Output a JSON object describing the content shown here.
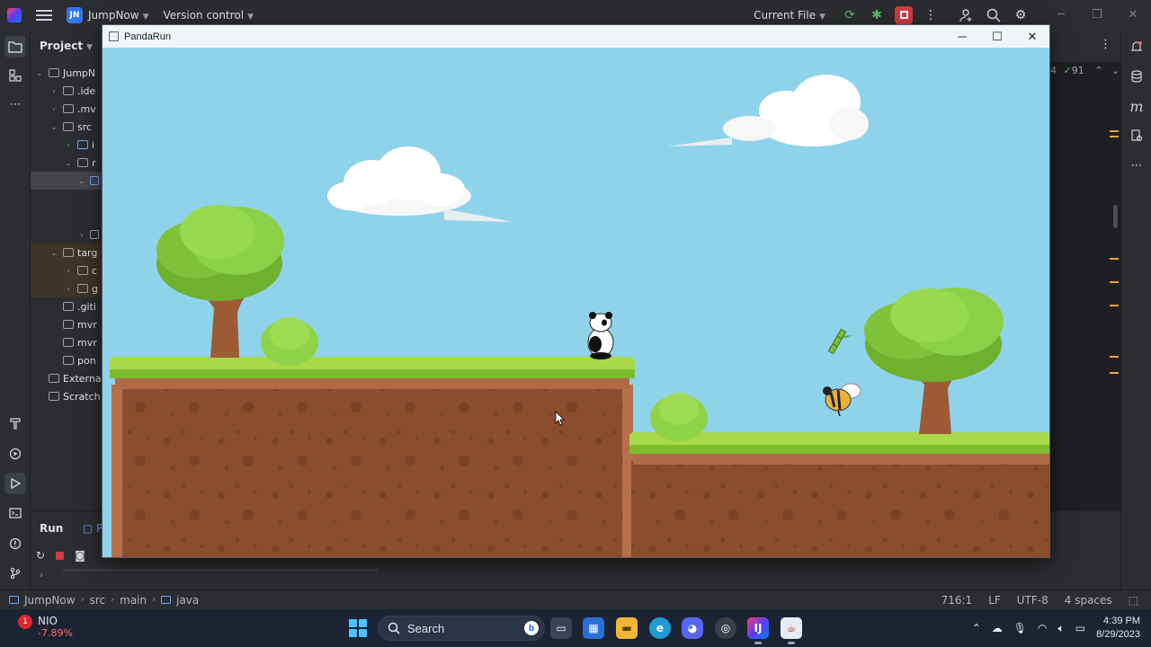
{
  "ide": {
    "project_badge": "JN",
    "project_name": "JumpNow",
    "vcs_label": "Version control",
    "run_config": "Current File",
    "project_panel_title": "Project",
    "tree": [
      {
        "label": "JumpN",
        "depth": 1,
        "expanded": true,
        "kind": "module"
      },
      {
        "label": ".ide",
        "depth": 2,
        "expanded": false,
        "kind": "folder"
      },
      {
        "label": ".mv",
        "depth": 2,
        "expanded": false,
        "kind": "folder"
      },
      {
        "label": "src",
        "depth": 2,
        "expanded": true,
        "kind": "folder"
      },
      {
        "label": "i",
        "depth": 3,
        "expanded": false,
        "kind": "folder-blue"
      },
      {
        "label": "r",
        "depth": 3,
        "expanded": true,
        "kind": "folder"
      },
      {
        "label": "",
        "depth": 4,
        "expanded": true,
        "kind": "selected"
      },
      {
        "label": "",
        "depth": 4,
        "expanded": false,
        "kind": "blank"
      },
      {
        "label": "",
        "depth": 4,
        "expanded": false,
        "kind": "blank"
      },
      {
        "label": "",
        "depth": 4,
        "expanded": false,
        "kind": "folder"
      },
      {
        "label": "targ",
        "depth": 2,
        "expanded": true,
        "kind": "excluded"
      },
      {
        "label": "c",
        "depth": 3,
        "expanded": false,
        "kind": "excluded"
      },
      {
        "label": "g",
        "depth": 3,
        "expanded": false,
        "kind": "excluded"
      },
      {
        "label": ".giti",
        "depth": 2,
        "expanded": false,
        "kind": "file"
      },
      {
        "label": "mvr",
        "depth": 2,
        "expanded": false,
        "kind": "file"
      },
      {
        "label": "mvr",
        "depth": 2,
        "expanded": false,
        "kind": "file"
      },
      {
        "label": "pon",
        "depth": 2,
        "expanded": false,
        "kind": "file"
      },
      {
        "label": "Externa",
        "depth": 1,
        "expanded": false,
        "kind": "file"
      },
      {
        "label": "Scratch",
        "depth": 1,
        "expanded": false,
        "kind": "file"
      }
    ],
    "inspection_warnings": "4",
    "inspection_ok": "91",
    "run_tab": "Run",
    "run_tab_2": "P",
    "breadcrumb": [
      "JumpNow",
      "src",
      "main",
      "java"
    ],
    "status": {
      "position": "716:1",
      "line_sep": "LF",
      "encoding": "UTF-8",
      "indent": "4 spaces"
    }
  },
  "game_window": {
    "title": "PandaRun",
    "sky_color": "#8fd3eb"
  },
  "taskbar": {
    "stock_badge": "1",
    "stock_symbol": "NIO",
    "stock_change": "-7.89%",
    "search_placeholder": "Search",
    "time": "4:39 PM",
    "date": "8/29/2023"
  }
}
